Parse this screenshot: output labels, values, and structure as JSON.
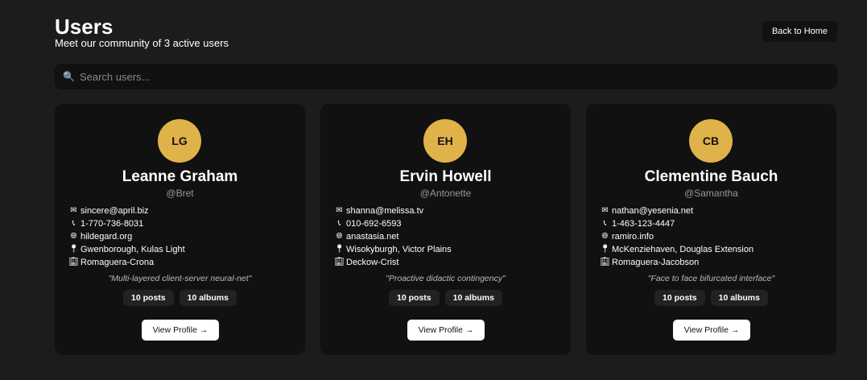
{
  "header": {
    "title": "Users",
    "subtitle": "Meet our community of 3 active users",
    "back_label": "Back to Home"
  },
  "search": {
    "placeholder": "Search users...",
    "icon": "magnifier-icon"
  },
  "colors": {
    "avatar": "#e0b24a",
    "card": "#111111",
    "background": "#1c1c1c"
  },
  "users": [
    {
      "initials": "LG",
      "name": "Leanne Graham",
      "username": "@Bret",
      "email": "sincere@april.biz",
      "phone": "1-770-736-8031",
      "website": "hildegard.org",
      "address": "Gwenborough, Kulas Light",
      "company": "Romaguera-Crona",
      "catchphrase": "\"Multi-layered client-server neural-net\"",
      "posts": "10 posts",
      "albums": "10 albums",
      "button": "View Profile →"
    },
    {
      "initials": "EH",
      "name": "Ervin Howell",
      "username": "@Antonette",
      "email": "shanna@melissa.tv",
      "phone": "010-692-6593",
      "website": "anastasia.net",
      "address": "Wisokyburgh, Victor Plains",
      "company": "Deckow-Crist",
      "catchphrase": "\"Proactive didactic contingency\"",
      "posts": "10 posts",
      "albums": "10 albums",
      "button": "View Profile →"
    },
    {
      "initials": "CB",
      "name": "Clementine Bauch",
      "username": "@Samantha",
      "email": "nathan@yesenia.net",
      "phone": "1-463-123-4447",
      "website": "ramiro.info",
      "address": "McKenziehaven, Douglas Extension",
      "company": "Romaguera-Jacobson",
      "catchphrase": "\"Face to face bifurcated interface\"",
      "posts": "10 posts",
      "albums": "10 albums",
      "button": "View Profile →"
    }
  ]
}
